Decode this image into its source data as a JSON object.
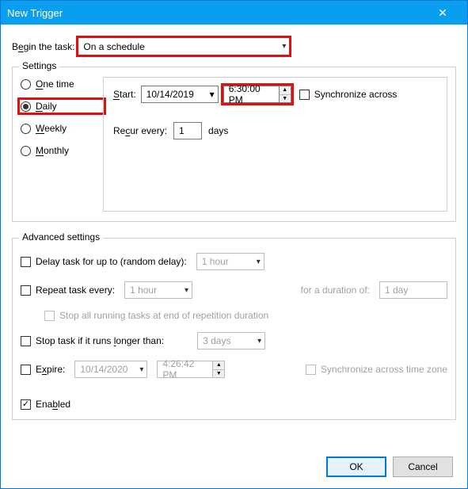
{
  "window": {
    "title": "New Trigger",
    "close": "✕"
  },
  "begin": {
    "label": "Begin the task:",
    "value": "On a schedule"
  },
  "settings": {
    "legend": "Settings",
    "radios": {
      "onetime_label": "One time",
      "daily_label": "Daily",
      "weekly_label": "Weekly",
      "monthly_label": "Monthly",
      "selected": "daily"
    },
    "start_label": "Start:",
    "start_date": "10/14/2019",
    "start_time": "6:30:00 PM",
    "sync_label": "Synchronize across",
    "recur_label": "Recur every:",
    "recur_value": "1",
    "recur_unit": "days"
  },
  "advanced": {
    "legend": "Advanced settings",
    "delay_label": "Delay task for up to (random delay):",
    "delay_value": "1 hour",
    "repeat_label": "Repeat task every:",
    "repeat_value": "1 hour",
    "duration_label": "for a duration of:",
    "duration_value": "1 day",
    "stop_all_label": "Stop all running tasks at end of repetition duration",
    "stop_if_label": "Stop task if it runs longer than:",
    "stop_if_value": "3 days",
    "expire_label": "Expire:",
    "expire_date": "10/14/2020",
    "expire_time": "4:26:42 PM",
    "sync_tz_label": "Synchronize across time zone",
    "enabled_label": "Enabled"
  },
  "buttons": {
    "ok": "OK",
    "cancel": "Cancel"
  }
}
